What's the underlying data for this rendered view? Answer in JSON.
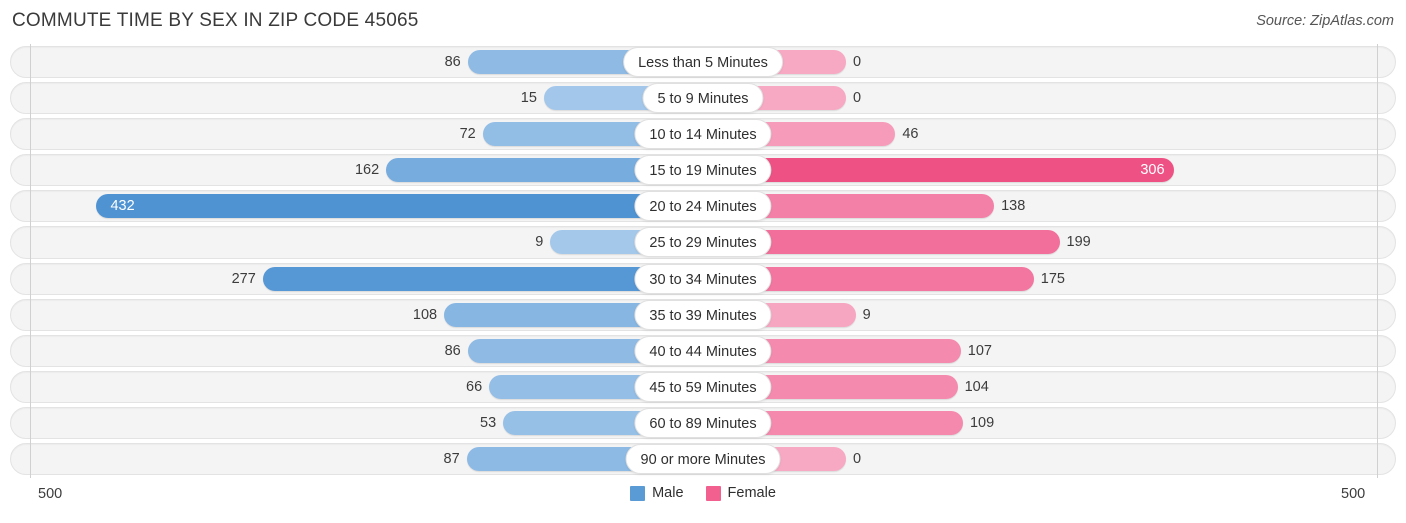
{
  "header": {
    "title": "COMMUTE TIME BY SEX IN ZIP CODE 45065",
    "source": "Source: ZipAtlas.com"
  },
  "legend": {
    "male_label": "Male",
    "female_label": "Female",
    "male_color": "#5B9BD5",
    "female_color": "#F1608E"
  },
  "axis": {
    "left_tick": "500",
    "right_tick": "500",
    "max": 500
  },
  "chart_data": {
    "type": "bar",
    "subtype": "diverging-bidirectional-bar",
    "title": "COMMUTE TIME BY SEX IN ZIP CODE 45065",
    "xlabel": "",
    "ylabel": "",
    "xlim": [
      500,
      500
    ],
    "grid": false,
    "legend_position": "bottom-center",
    "categories": [
      "Less than 5 Minutes",
      "5 to 9 Minutes",
      "10 to 14 Minutes",
      "15 to 19 Minutes",
      "20 to 24 Minutes",
      "25 to 29 Minutes",
      "30 to 34 Minutes",
      "35 to 39 Minutes",
      "40 to 44 Minutes",
      "45 to 59 Minutes",
      "60 to 89 Minutes",
      "90 or more Minutes"
    ],
    "series": [
      {
        "name": "Male",
        "color": "#5B9BD5",
        "direction": "left",
        "values": [
          86,
          15,
          72,
          162,
          432,
          9,
          277,
          108,
          86,
          66,
          53,
          87
        ]
      },
      {
        "name": "Female",
        "color": "#F1608E",
        "direction": "right",
        "values": [
          0,
          0,
          46,
          306,
          138,
          199,
          175,
          9,
          107,
          104,
          109,
          0
        ]
      }
    ]
  },
  "rows": [
    {
      "label": "Less than 5 Minutes",
      "male": "86",
      "female": "0",
      "male_v": 86,
      "female_v": 0
    },
    {
      "label": "5 to 9 Minutes",
      "male": "15",
      "female": "0",
      "male_v": 15,
      "female_v": 0
    },
    {
      "label": "10 to 14 Minutes",
      "male": "72",
      "female": "46",
      "male_v": 72,
      "female_v": 46
    },
    {
      "label": "15 to 19 Minutes",
      "male": "162",
      "female": "306",
      "male_v": 162,
      "female_v": 306
    },
    {
      "label": "20 to 24 Minutes",
      "male": "432",
      "female": "138",
      "male_v": 432,
      "female_v": 138
    },
    {
      "label": "25 to 29 Minutes",
      "male": "9",
      "female": "199",
      "male_v": 9,
      "female_v": 199
    },
    {
      "label": "30 to 34 Minutes",
      "male": "277",
      "female": "175",
      "male_v": 277,
      "female_v": 175
    },
    {
      "label": "35 to 39 Minutes",
      "male": "108",
      "female": "9",
      "male_v": 108,
      "female_v": 9
    },
    {
      "label": "40 to 44 Minutes",
      "male": "86",
      "female": "107",
      "male_v": 86,
      "female_v": 107
    },
    {
      "label": "45 to 59 Minutes",
      "male": "66",
      "female": "104",
      "male_v": 66,
      "female_v": 104
    },
    {
      "label": "60 to 89 Minutes",
      "male": "53",
      "female": "109",
      "male_v": 53,
      "female_v": 109
    },
    {
      "label": "90 or more Minutes",
      "male": "87",
      "female": "0",
      "male_v": 87,
      "female_v": 0
    }
  ]
}
